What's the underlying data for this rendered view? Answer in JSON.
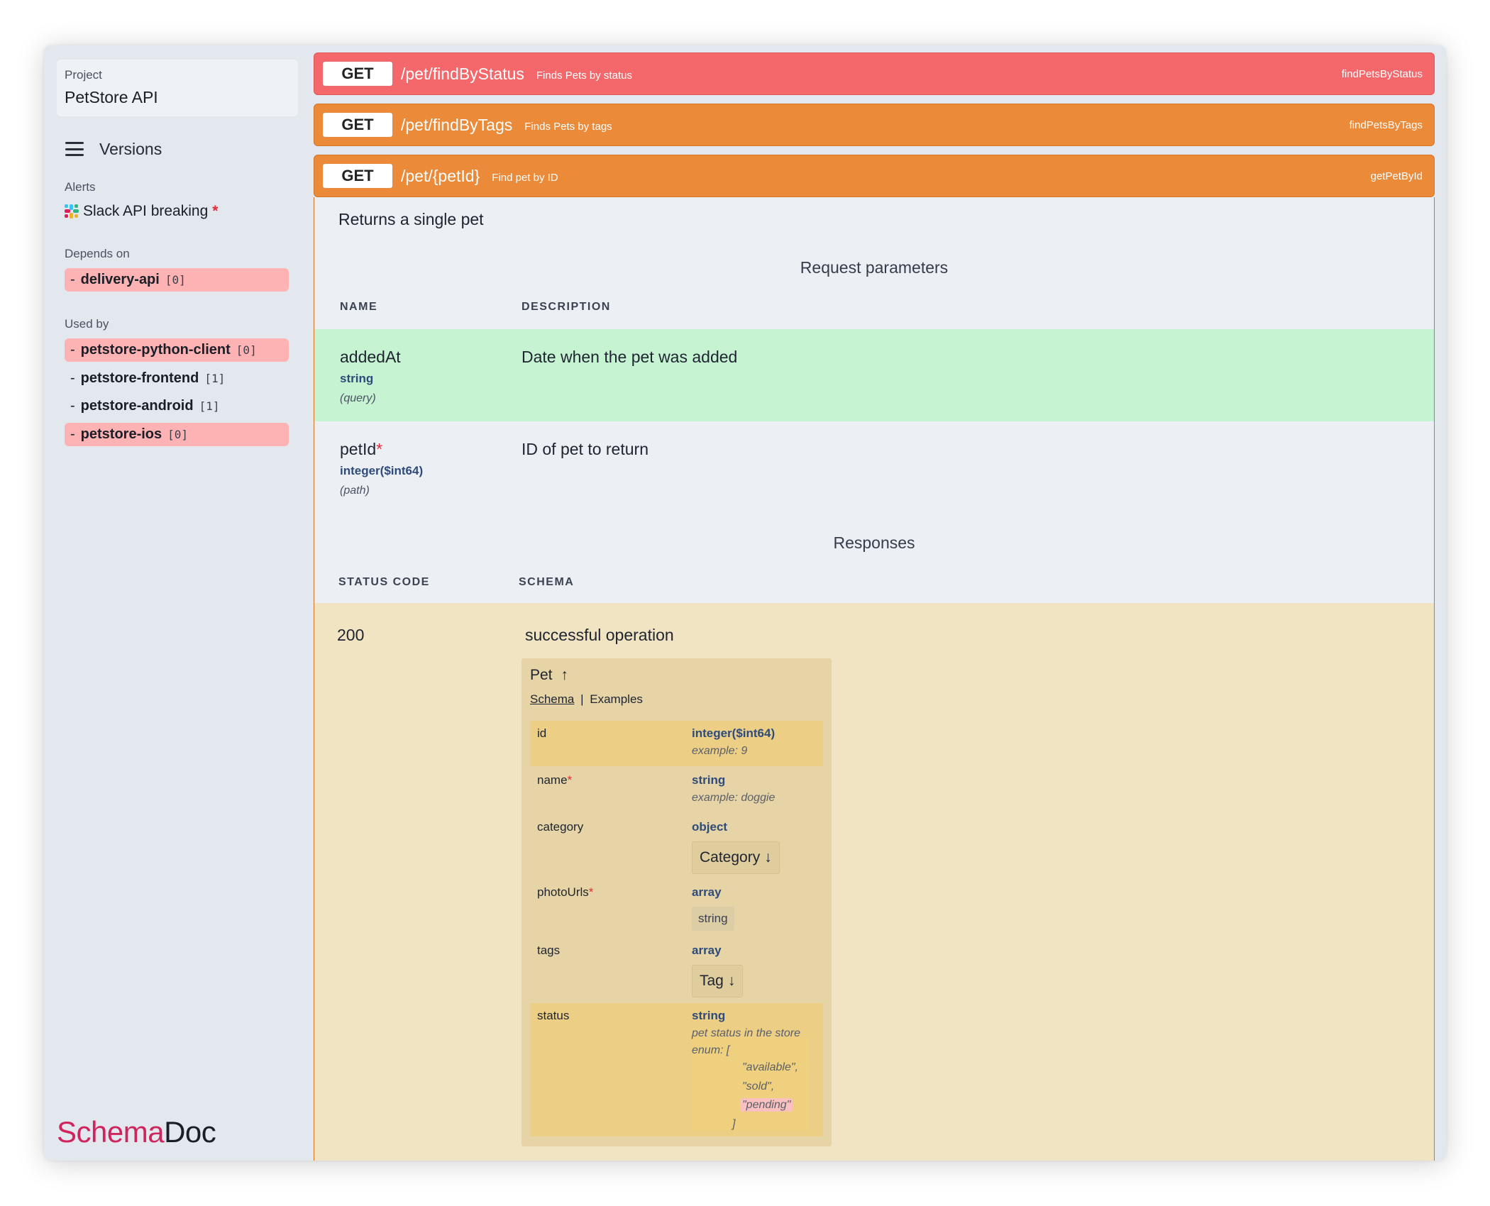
{
  "sidebar": {
    "project_label": "Project",
    "project_name": "PetStore API",
    "versions_label": "Versions",
    "alerts_label": "Alerts",
    "alert": {
      "text": "Slack API breaking",
      "marker": "*"
    },
    "depends_label": "Depends on",
    "depends": [
      {
        "dash": "-",
        "name": "delivery-api",
        "count": "[0]",
        "highlight": true
      }
    ],
    "usedby_label": "Used by",
    "usedby": [
      {
        "dash": "-",
        "name": "petstore-python-client",
        "count": "[0]",
        "highlight": true
      },
      {
        "dash": "-",
        "name": "petstore-frontend",
        "count": "[1]",
        "highlight": false
      },
      {
        "dash": "-",
        "name": "petstore-android",
        "count": "[1]",
        "highlight": false
      },
      {
        "dash": "-",
        "name": "petstore-ios",
        "count": "[0]",
        "highlight": true
      }
    ],
    "brand_a": "Schema",
    "brand_b": "Doc"
  },
  "operations": [
    {
      "method": "GET",
      "path": "/pet/findByStatus",
      "summary": "Finds Pets by status",
      "operation_id": "findPetsByStatus",
      "color": "#f4676a"
    },
    {
      "method": "GET",
      "path": "/pet/findByTags",
      "summary": "Finds Pets by tags",
      "operation_id": "findPetsByTags",
      "color": "#eb8a38"
    },
    {
      "method": "GET",
      "path": "/pet/{petId}",
      "summary": "Find pet by ID",
      "operation_id": "getPetById",
      "color": "#eb8a38"
    }
  ],
  "detail": {
    "description": "Returns a single pet",
    "request_title": "Request parameters",
    "col_name": "NAME",
    "col_description": "DESCRIPTION",
    "params": [
      {
        "name": "addedAt",
        "required": "",
        "type": "string",
        "in": "(query)",
        "description": "Date when the pet was added"
      },
      {
        "name": "petId",
        "required": "*",
        "type": "integer($int64)",
        "in": "(path)",
        "description": "ID of pet to return"
      }
    ],
    "responses_title": "Responses",
    "col_status": "STATUS CODE",
    "col_schema": "SCHEMA",
    "response": {
      "code": "200",
      "description": "successful operation",
      "model": {
        "title": "Pet",
        "tab_schema": "Schema",
        "tab_sep": "|",
        "tab_examples": "Examples",
        "props": [
          {
            "name": "id",
            "required": "",
            "type": "integer($int64)",
            "example": "example: 9"
          },
          {
            "name": "name",
            "required": "*",
            "type": "string",
            "example": "example: doggie"
          },
          {
            "name": "category",
            "required": "",
            "type": "object",
            "ref": "Category"
          },
          {
            "name": "photoUrls",
            "required": "*",
            "type": "array",
            "item": "string"
          },
          {
            "name": "tags",
            "required": "",
            "type": "array",
            "ref": "Tag"
          },
          {
            "name": "status",
            "required": "",
            "type": "string",
            "description": "pet status in the store",
            "enum_open": "enum: [",
            "enum_values": [
              "\"available\",",
              "\"sold\",",
              "\"pending\""
            ],
            "enum_close": "]"
          }
        ]
      }
    }
  }
}
